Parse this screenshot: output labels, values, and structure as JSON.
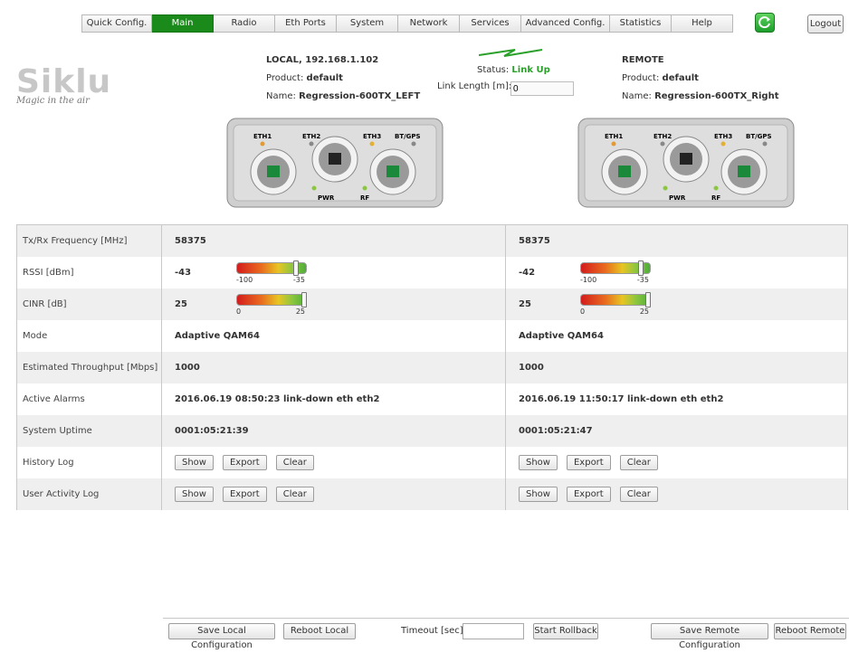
{
  "nav": {
    "tabs": [
      {
        "label": "Quick Config.",
        "active": false
      },
      {
        "label": "Main",
        "active": true
      },
      {
        "label": "Radio",
        "active": false
      },
      {
        "label": "Eth Ports",
        "active": false
      },
      {
        "label": "System",
        "active": false
      },
      {
        "label": "Network",
        "active": false
      },
      {
        "label": "Services",
        "active": false
      },
      {
        "label": "Advanced Config.",
        "active": false
      },
      {
        "label": "Statistics",
        "active": false
      },
      {
        "label": "Help",
        "active": false
      }
    ],
    "refresh_icon": "refresh-icon",
    "logout_label": "Logout"
  },
  "logo": {
    "brand": "Siklu",
    "tagline": "Magic in the air"
  },
  "local": {
    "title": "LOCAL, 192.168.1.102",
    "product_label": "Product:",
    "product_value": "default",
    "name_label": "Name:",
    "name_value": "Regression-600TX_LEFT"
  },
  "remote": {
    "title": "REMOTE",
    "product_label": "Product:",
    "product_value": "default",
    "name_label": "Name:",
    "name_value": "Regression-600TX_Right"
  },
  "link": {
    "status_label": "Status:",
    "status_value": "Link Up",
    "length_label": "Link Length [m]:",
    "length_value": "0"
  },
  "device_ports": {
    "eth1": "ETH1",
    "eth2": "ETH2",
    "eth3": "ETH3",
    "btgps": "BT/GPS",
    "pwr": "PWR",
    "rf": "RF"
  },
  "rows": {
    "freq": {
      "label": "Tx/Rx Frequency [MHz]",
      "local": "58375",
      "remote": "58375"
    },
    "rssi": {
      "label": "RSSI [dBm]",
      "local": "-43",
      "remote": "-42",
      "min": "-100",
      "max": "-35",
      "local_level": 0.88,
      "remote_level": 0.89
    },
    "cinr": {
      "label": "CINR [dB]",
      "local": "25",
      "remote": "25",
      "min": "0",
      "max": "25",
      "local_level": 1.0,
      "remote_level": 1.0
    },
    "mode": {
      "label": "Mode",
      "local": "Adaptive QAM64",
      "remote": "Adaptive QAM64"
    },
    "throughput": {
      "label": "Estimated Throughput [Mbps]",
      "local": "1000",
      "remote": "1000"
    },
    "alarms": {
      "label": "Active Alarms",
      "local": "2016.06.19 08:50:23 link-down eth eth2",
      "remote": "2016.06.19 11:50:17 link-down eth eth2"
    },
    "uptime": {
      "label": "System Uptime",
      "local": "0001:05:21:39",
      "remote": "0001:05:21:47"
    },
    "history": {
      "label": "History Log"
    },
    "activity": {
      "label": "User Activity Log"
    }
  },
  "log_buttons": {
    "show": "Show",
    "export": "Export",
    "clear": "Clear"
  },
  "footer": {
    "save_local": "Save Local Configuration",
    "reboot_local": "Reboot Local",
    "timeout_label": "Timeout [sec]:",
    "timeout_value": "",
    "start_rollback": "Start Rollback",
    "save_remote": "Save Remote Configuration",
    "reboot_remote": "Reboot Remote"
  },
  "colors": {
    "active_tab": "#1a8a1a",
    "link_up": "#2aa02a",
    "row_alt": "#efefef"
  }
}
